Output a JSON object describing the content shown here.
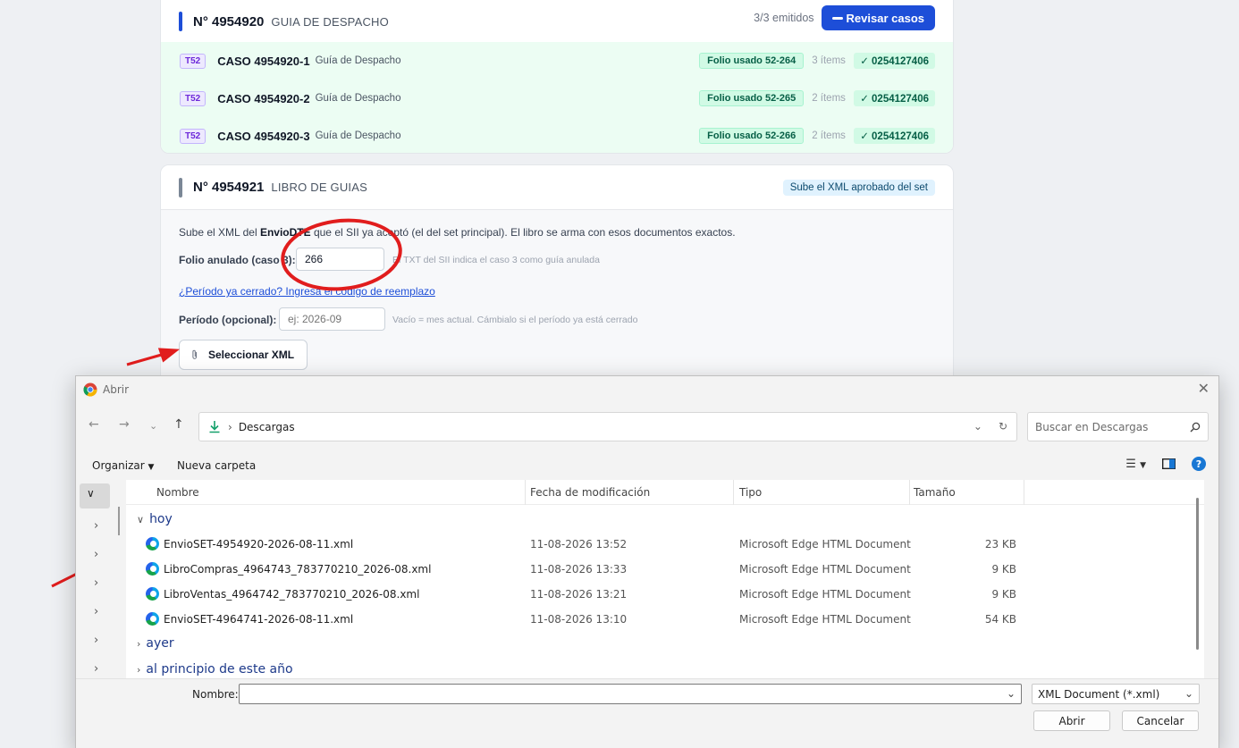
{
  "card1": {
    "number": "N° 4954920",
    "kind": "GUIA DE DESPACHO",
    "emitted": "3/3 emitidos",
    "review_button": "Revisar casos",
    "rows": [
      {
        "tag": "T52",
        "name": "CASO 4954920-1",
        "type": "Guía de Despacho",
        "folio": "Folio usado 52-264",
        "items": "3 ítems",
        "ok": "✓ 0254127406"
      },
      {
        "tag": "T52",
        "name": "CASO 4954920-2",
        "type": "Guía de Despacho",
        "folio": "Folio usado 52-265",
        "items": "2 ítems",
        "ok": "✓ 0254127406"
      },
      {
        "tag": "T52",
        "name": "CASO 4954920-3",
        "type": "Guía de Despacho",
        "folio": "Folio usado 52-266",
        "items": "2 ítems",
        "ok": "✓ 0254127406"
      }
    ]
  },
  "card2": {
    "number": "N° 4954921",
    "kind": "LIBRO DE GUIAS",
    "hint_badge": "Sube el XML aprobado del set",
    "desc_pre": "Sube el XML del ",
    "desc_bold": "EnvioDTE",
    "desc_post": " que el SII ya aceptó (el del set principal). El libro se arma con esos documentos exactos.",
    "folio_label": "Folio anulado (caso 3):",
    "folio_value": "266",
    "folio_hint": "El TXT del SII indica el caso 3 como guía anulada",
    "closed_link": "¿Período ya cerrado? Ingresa el código de reemplazo",
    "period_label": "Período (opcional):",
    "period_placeholder": "ej: 2026-09",
    "period_hint": "Vacío = mes actual. Cámbialo si el período ya está cerrado",
    "select_button": "Seleccionar XML"
  },
  "dialog": {
    "title": "Abrir",
    "address": "Descargas",
    "search_placeholder": "Buscar en Descargas",
    "organize": "Organizar",
    "new_folder": "Nueva carpeta",
    "columns": {
      "name": "Nombre",
      "date": "Fecha de modificación",
      "type": "Tipo",
      "size": "Tamaño"
    },
    "groups": {
      "today": "hoy",
      "yesterday": "ayer",
      "this_year": "al principio de este año"
    },
    "files": [
      {
        "name": "EnvioSET-4954920-2026-08-11.xml",
        "date": "11-08-2026 13:52",
        "type": "Microsoft Edge HTML Document",
        "size": "23 KB"
      },
      {
        "name": "LibroCompras_4964743_783770210_2026-08.xml",
        "date": "11-08-2026 13:33",
        "type": "Microsoft Edge HTML Document",
        "size": "9 KB"
      },
      {
        "name": "LibroVentas_4964742_783770210_2026-08.xml",
        "date": "11-08-2026 13:21",
        "type": "Microsoft Edge HTML Document",
        "size": "9 KB"
      },
      {
        "name": "EnvioSET-4964741-2026-08-11.xml",
        "date": "11-08-2026 13:10",
        "type": "Microsoft Edge HTML Document",
        "size": "54 KB"
      }
    ],
    "filename_label": "Nombre:",
    "filename_value": "",
    "filter": "XML Document (*.xml)",
    "open_button": "Abrir",
    "cancel_button": "Cancelar"
  },
  "colors": {
    "primary": "#1d4ed8",
    "success_bg": "#d1fae5",
    "annotation": "#e11d1d"
  }
}
